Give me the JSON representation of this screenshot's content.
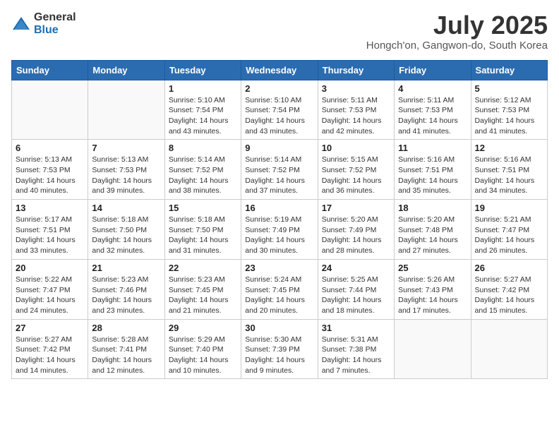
{
  "header": {
    "logo_general": "General",
    "logo_blue": "Blue",
    "month_title": "July 2025",
    "location": "Hongch'on, Gangwon-do, South Korea"
  },
  "calendar": {
    "days_of_week": [
      "Sunday",
      "Monday",
      "Tuesday",
      "Wednesday",
      "Thursday",
      "Friday",
      "Saturday"
    ],
    "weeks": [
      [
        {
          "day": "",
          "info": ""
        },
        {
          "day": "",
          "info": ""
        },
        {
          "day": "1",
          "info": "Sunrise: 5:10 AM\nSunset: 7:54 PM\nDaylight: 14 hours and 43 minutes."
        },
        {
          "day": "2",
          "info": "Sunrise: 5:10 AM\nSunset: 7:54 PM\nDaylight: 14 hours and 43 minutes."
        },
        {
          "day": "3",
          "info": "Sunrise: 5:11 AM\nSunset: 7:53 PM\nDaylight: 14 hours and 42 minutes."
        },
        {
          "day": "4",
          "info": "Sunrise: 5:11 AM\nSunset: 7:53 PM\nDaylight: 14 hours and 41 minutes."
        },
        {
          "day": "5",
          "info": "Sunrise: 5:12 AM\nSunset: 7:53 PM\nDaylight: 14 hours and 41 minutes."
        }
      ],
      [
        {
          "day": "6",
          "info": "Sunrise: 5:13 AM\nSunset: 7:53 PM\nDaylight: 14 hours and 40 minutes."
        },
        {
          "day": "7",
          "info": "Sunrise: 5:13 AM\nSunset: 7:53 PM\nDaylight: 14 hours and 39 minutes."
        },
        {
          "day": "8",
          "info": "Sunrise: 5:14 AM\nSunset: 7:52 PM\nDaylight: 14 hours and 38 minutes."
        },
        {
          "day": "9",
          "info": "Sunrise: 5:14 AM\nSunset: 7:52 PM\nDaylight: 14 hours and 37 minutes."
        },
        {
          "day": "10",
          "info": "Sunrise: 5:15 AM\nSunset: 7:52 PM\nDaylight: 14 hours and 36 minutes."
        },
        {
          "day": "11",
          "info": "Sunrise: 5:16 AM\nSunset: 7:51 PM\nDaylight: 14 hours and 35 minutes."
        },
        {
          "day": "12",
          "info": "Sunrise: 5:16 AM\nSunset: 7:51 PM\nDaylight: 14 hours and 34 minutes."
        }
      ],
      [
        {
          "day": "13",
          "info": "Sunrise: 5:17 AM\nSunset: 7:51 PM\nDaylight: 14 hours and 33 minutes."
        },
        {
          "day": "14",
          "info": "Sunrise: 5:18 AM\nSunset: 7:50 PM\nDaylight: 14 hours and 32 minutes."
        },
        {
          "day": "15",
          "info": "Sunrise: 5:18 AM\nSunset: 7:50 PM\nDaylight: 14 hours and 31 minutes."
        },
        {
          "day": "16",
          "info": "Sunrise: 5:19 AM\nSunset: 7:49 PM\nDaylight: 14 hours and 30 minutes."
        },
        {
          "day": "17",
          "info": "Sunrise: 5:20 AM\nSunset: 7:49 PM\nDaylight: 14 hours and 28 minutes."
        },
        {
          "day": "18",
          "info": "Sunrise: 5:20 AM\nSunset: 7:48 PM\nDaylight: 14 hours and 27 minutes."
        },
        {
          "day": "19",
          "info": "Sunrise: 5:21 AM\nSunset: 7:47 PM\nDaylight: 14 hours and 26 minutes."
        }
      ],
      [
        {
          "day": "20",
          "info": "Sunrise: 5:22 AM\nSunset: 7:47 PM\nDaylight: 14 hours and 24 minutes."
        },
        {
          "day": "21",
          "info": "Sunrise: 5:23 AM\nSunset: 7:46 PM\nDaylight: 14 hours and 23 minutes."
        },
        {
          "day": "22",
          "info": "Sunrise: 5:23 AM\nSunset: 7:45 PM\nDaylight: 14 hours and 21 minutes."
        },
        {
          "day": "23",
          "info": "Sunrise: 5:24 AM\nSunset: 7:45 PM\nDaylight: 14 hours and 20 minutes."
        },
        {
          "day": "24",
          "info": "Sunrise: 5:25 AM\nSunset: 7:44 PM\nDaylight: 14 hours and 18 minutes."
        },
        {
          "day": "25",
          "info": "Sunrise: 5:26 AM\nSunset: 7:43 PM\nDaylight: 14 hours and 17 minutes."
        },
        {
          "day": "26",
          "info": "Sunrise: 5:27 AM\nSunset: 7:42 PM\nDaylight: 14 hours and 15 minutes."
        }
      ],
      [
        {
          "day": "27",
          "info": "Sunrise: 5:27 AM\nSunset: 7:42 PM\nDaylight: 14 hours and 14 minutes."
        },
        {
          "day": "28",
          "info": "Sunrise: 5:28 AM\nSunset: 7:41 PM\nDaylight: 14 hours and 12 minutes."
        },
        {
          "day": "29",
          "info": "Sunrise: 5:29 AM\nSunset: 7:40 PM\nDaylight: 14 hours and 10 minutes."
        },
        {
          "day": "30",
          "info": "Sunrise: 5:30 AM\nSunset: 7:39 PM\nDaylight: 14 hours and 9 minutes."
        },
        {
          "day": "31",
          "info": "Sunrise: 5:31 AM\nSunset: 7:38 PM\nDaylight: 14 hours and 7 minutes."
        },
        {
          "day": "",
          "info": ""
        },
        {
          "day": "",
          "info": ""
        }
      ]
    ]
  }
}
